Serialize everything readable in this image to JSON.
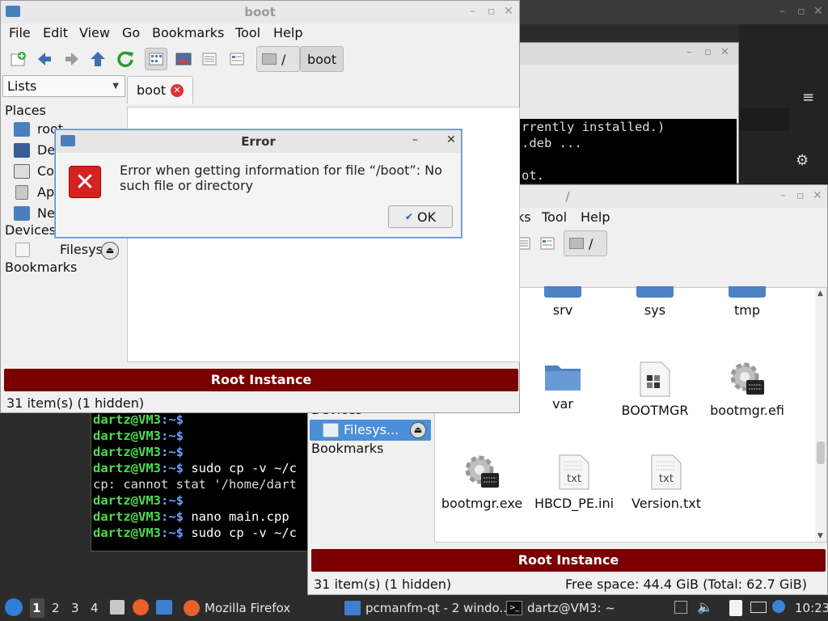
{
  "topbar": {
    "title": "boot"
  },
  "win1": {
    "title": "boot",
    "menu": [
      "File",
      "Edit",
      "View",
      "Go",
      "Bookmarks",
      "Tool",
      "Help"
    ],
    "path_root": "/",
    "path_current": "boot",
    "sidebar_mode": "Lists",
    "tab_label": "boot",
    "sidebar": {
      "places_header": "Places",
      "places": [
        "root",
        "De",
        "Co",
        "Ap",
        "Ne"
      ],
      "devices_header": "Devices",
      "device": "Filesys...",
      "bookmarks_header": "Bookmarks"
    },
    "root_bar": "Root Instance",
    "status": "31 item(s) (1 hidden)"
  },
  "dialog": {
    "title": "Error",
    "message": "Error when getting information for file “/boot”: No such file or directory",
    "ok": "OK"
  },
  "win2": {
    "title": "/",
    "menu": [
      "ks",
      "Tool",
      "Help"
    ],
    "path_root": "/",
    "devices_header": "Devices",
    "device": "Filesys...",
    "bookmarks_header": "Bookmarks",
    "files": [
      {
        "name": "srv",
        "icon": "folder"
      },
      {
        "name": "sys",
        "icon": "folder"
      },
      {
        "name": "tmp",
        "icon": "folder"
      },
      {
        "name": "var",
        "icon": "folder"
      },
      {
        "name": "BOOTMGR",
        "icon": "binary-file"
      },
      {
        "name": "bootmgr.efi",
        "icon": "executable"
      },
      {
        "name": "bootmgr.exe",
        "icon": "executable"
      },
      {
        "name": "HBCD_PE.ini",
        "icon": "text-file"
      },
      {
        "name": "Version.txt",
        "icon": "text-file"
      }
    ],
    "txt_badge": "txt",
    "root_bar": "Root Instance",
    "status": "31 item(s) (1 hidden)",
    "free_space": "Free space: 44.4 GiB (Total: 62.7 GiB)"
  },
  "term_mid": {
    "lines": [
      "rrently installed.)",
      ".deb ...",
      "",
      "ot."
    ]
  },
  "terminal": {
    "prompt_user": "dartz@VM3",
    "prompt_path": ":~$",
    "lines": [
      {
        "cmd": ""
      },
      {
        "cmd": ""
      },
      {
        "cmd": ""
      },
      {
        "cmd": " sudo cp -v ~/c"
      },
      {
        "out": "cp: cannot stat '/home/dart"
      },
      {
        "cmd": ""
      },
      {
        "cmd": " nano main.cpp"
      },
      {
        "cmd": " sudo cp -v ~/c"
      }
    ]
  },
  "taskbar": {
    "workspaces": [
      "1",
      "2",
      "3",
      "4"
    ],
    "tasks": [
      "Mozilla Firefox",
      "pcmanfm-qt - 2 windo...",
      "dartz@VM3: ~"
    ],
    "clock": "10:23"
  }
}
